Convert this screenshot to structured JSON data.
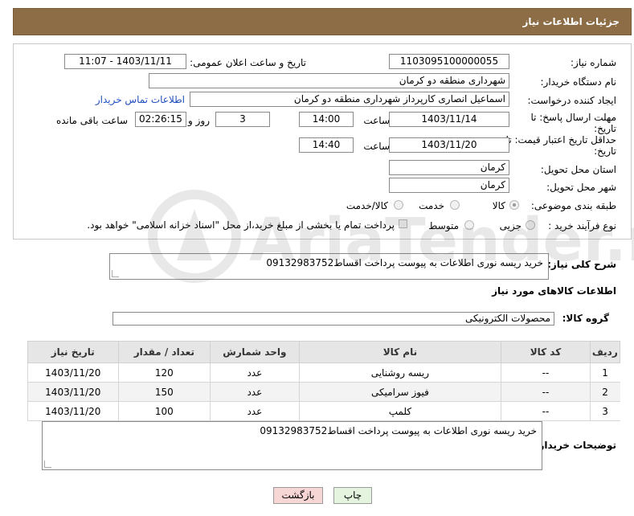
{
  "header": {
    "title": "جزئیات اطلاعات نیاز"
  },
  "form": {
    "need_number_label": "شماره نیاز:",
    "need_number": "1103095100000055",
    "announce_label": "تاریخ و ساعت اعلان عمومی:",
    "announce_value": "1403/11/11 - 11:07",
    "buyer_org_label": "نام دستگاه خریدار:",
    "buyer_org": "شهرداری منطقه دو کرمان",
    "requester_label": "ایجاد کننده درخواست:",
    "requester": "اسماعیل انصاری کارپرداز شهرداری منطقه دو کرمان",
    "contact_link": "اطلاعات تماس خریدار",
    "reply_deadline_label_1": "مهلت ارسال پاسخ: تا",
    "reply_deadline_label_2": "تاریخ:",
    "reply_date": "1403/11/14",
    "time_label": "ساعت",
    "reply_time": "14:00",
    "days_count": "3",
    "days_and_label": "روز و",
    "remaining_time": "02:26:15",
    "remaining_label": "ساعت باقی مانده",
    "price_validity_label_1": "حداقل تاریخ اعتبار قیمت: تا",
    "price_validity_label_2": "تاریخ:",
    "price_date": "1403/11/20",
    "price_time": "14:40",
    "province_label": "استان محل تحویل:",
    "province": "کرمان",
    "city_label": "شهر محل تحویل:",
    "city": "کرمان",
    "category_label": "طبقه بندی موضوعی:",
    "category_options": [
      "کالا",
      "خدمت",
      "کالا/خدمت"
    ],
    "process_label": "نوع فرآیند خرید :",
    "process_options": [
      "جزیی",
      "متوسط"
    ],
    "payment_note": "پرداخت تمام یا بخشی از مبلغ خرید،از محل \"اسناد خزانه اسلامی\" خواهد بود."
  },
  "description": {
    "label": "شرح کلی نیاز:",
    "text": "خرید ریسه نوری اطلاعات به پیوست  پرداخت اقساط09132983752"
  },
  "goods_info": {
    "section_title": "اطلاعات کالاهای مورد نیاز",
    "group_label": "گروه کالا:",
    "group_value": "محصولات الکترونیکی"
  },
  "table": {
    "headers": [
      "ردیف",
      "کد کالا",
      "نام کالا",
      "واحد شمارش",
      "تعداد / مقدار",
      "تاریخ نیاز"
    ],
    "rows": [
      [
        "1",
        "--",
        "ریسه روشنایی",
        "عدد",
        "120",
        "1403/11/20"
      ],
      [
        "2",
        "--",
        "فیوز سرامیکی",
        "عدد",
        "150",
        "1403/11/20"
      ],
      [
        "3",
        "--",
        "کلمپ",
        "عدد",
        "100",
        "1403/11/20"
      ]
    ]
  },
  "buyer_notes": {
    "label": "توضیحات خریدار:",
    "text": "خرید ریسه نوری اطلاعات به پیوست  پرداخت اقساط09132983752"
  },
  "buttons": {
    "print": "چاپ",
    "back": "بازگشت"
  },
  "watermark": {
    "text": "AriaTender.neT"
  },
  "colors": {
    "header_bg": "#8c6d45",
    "link": "#1f4fbf",
    "back_button_bg": "#f7d6d6",
    "print_button_bg": "#e4f4df"
  }
}
